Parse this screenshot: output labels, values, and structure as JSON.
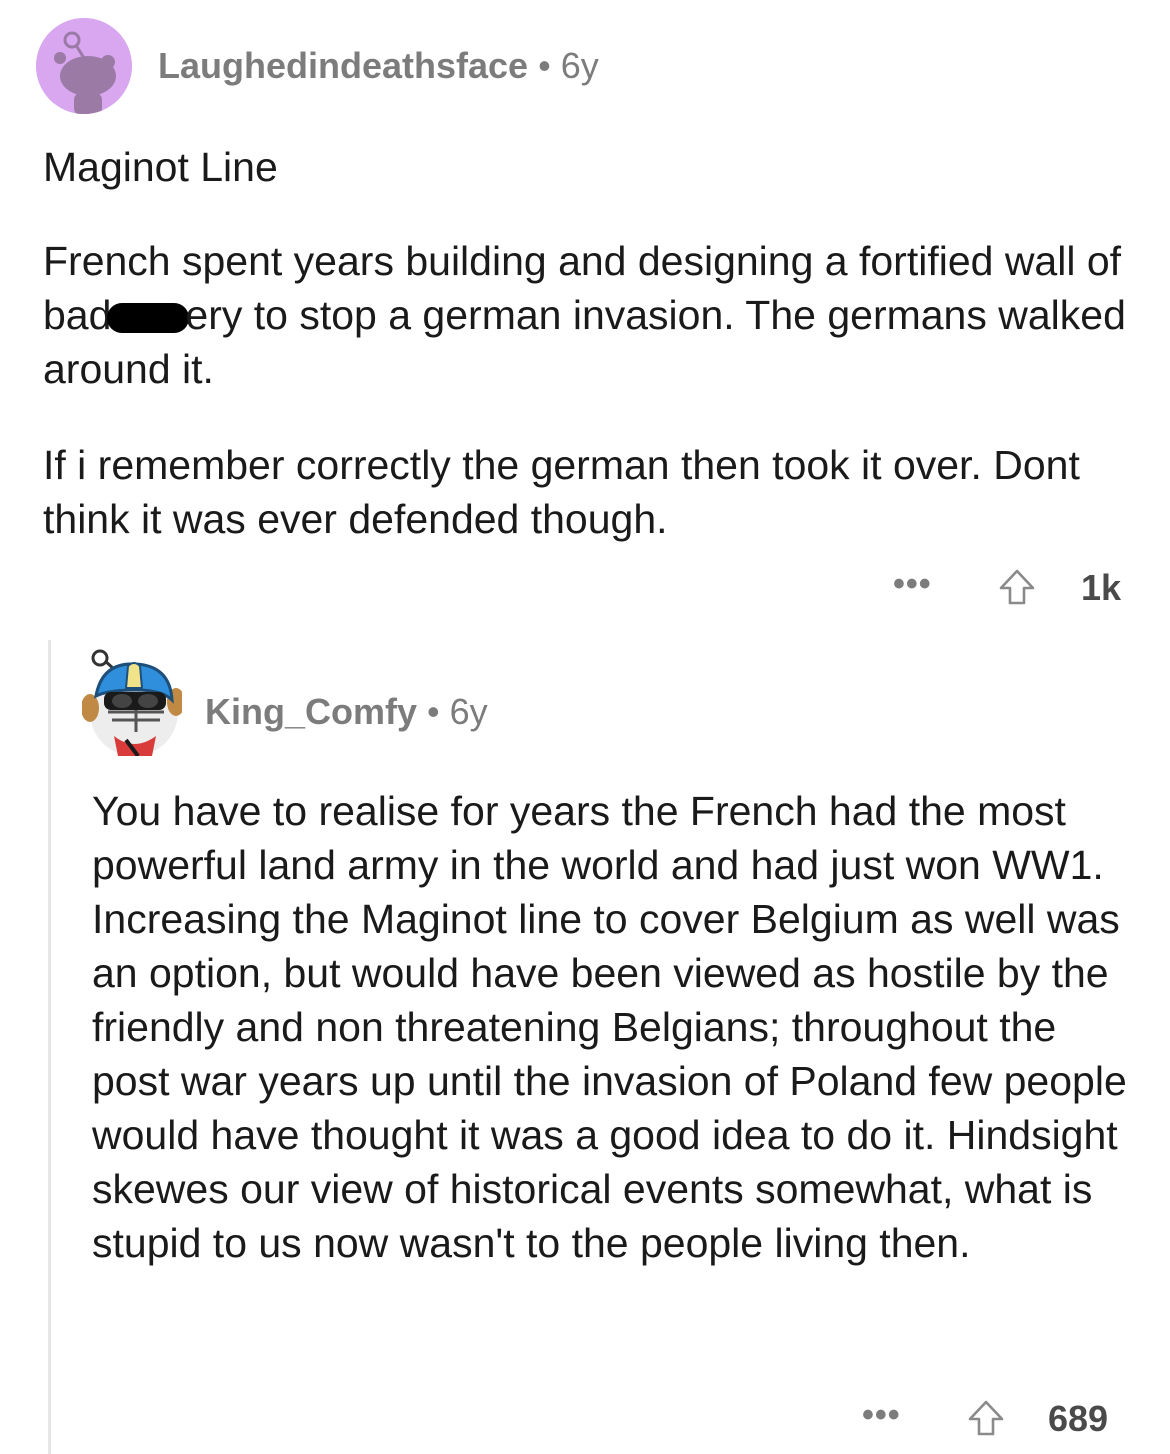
{
  "comment": {
    "username": "Laughedindeathsface",
    "separator": "•",
    "age": "6y",
    "title": "Maginot Line",
    "paragraph1_before": "French spent years building and designing a fortified wall of bad",
    "paragraph1_after": "ery to stop a german invasion. The germans walked around it.",
    "paragraph2": "If i remember correctly the german then took it over. Dont think it was ever defended though.",
    "more_label": "•••",
    "score": "1k",
    "avatar_color": "#d9a6f0"
  },
  "reply": {
    "username": "King_Comfy",
    "separator": "•",
    "age": "6y",
    "body": "You have to realise for years the French had the most powerful land army in the world and had just won WW1. Increasing the Maginot line to cover Belgium as well was an option, but would have been viewed as hostile by the friendly and non threatening Belgians; throughout the post war years up until the invasion of Poland few people would have thought it was a good idea to do it. Hindsight skewes our view of historical events somewhat, what is stupid to us now wasn't to the people living then.",
    "more_label": "•••",
    "score": "689"
  },
  "icons": {
    "upvote": "upvote-arrow-icon",
    "more": "more-options-icon"
  },
  "colors": {
    "meta_text": "#7c7c7c",
    "body_text": "#1a1a1b",
    "thread_line": "#e6e6e6"
  }
}
